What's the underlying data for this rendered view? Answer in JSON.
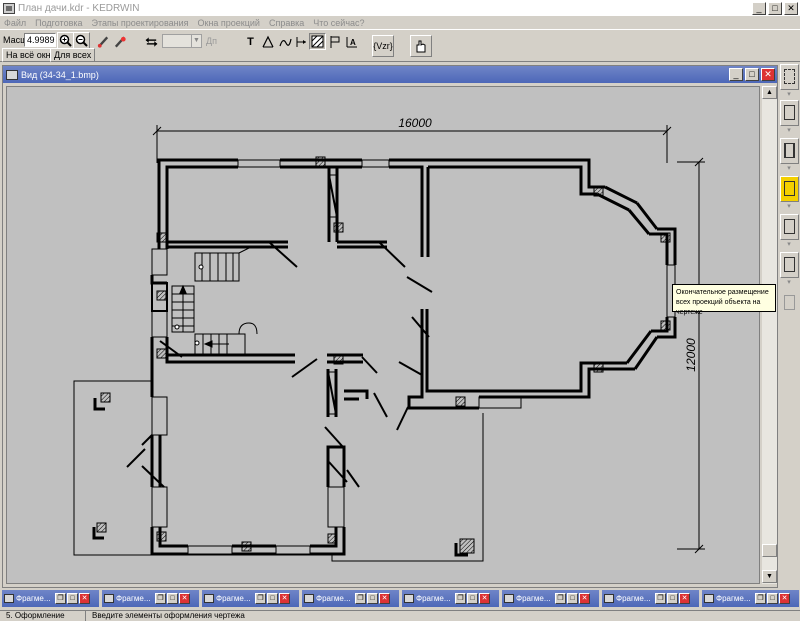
{
  "window": {
    "title": "План дачи.kdr - KEDRWIN",
    "minimize": "_",
    "maximize": "□",
    "close": "✕"
  },
  "menu": [
    "Файл",
    "Подготовка",
    "Этапы проектирования",
    "Окна проекций",
    "Справка",
    "Что сейчас?"
  ],
  "toolbar": {
    "scale_label": "Масшт",
    "scale_value": "4.9989",
    "fit_window": "На всё окно",
    "for_all": "Для всех",
    "combo_hint": "Дп",
    "formula_btn": "{Vzr}",
    "icons": [
      "zoom-in-icon",
      "zoom-out-icon",
      "pencil-icon",
      "eraser-icon",
      "arrows-icon",
      "text-icon",
      "angle-icon",
      "dimension-icon",
      "hatch-icon",
      "flag-icon",
      "leader-icon",
      "hand-icon"
    ]
  },
  "view": {
    "title": "Вид (34-34_1.bmp)",
    "dim_horizontal": "16000",
    "dim_vertical": "12000"
  },
  "tooltip": "Окончательное размещение всех проекций объекта на чертеже",
  "right_panel": {
    "buttons": [
      "fragment-icon",
      "stairs-icon",
      "level-icon",
      "placement-icon",
      "text-edit-icon",
      "sheet-icon",
      "print-icon"
    ]
  },
  "taskbar": {
    "items": [
      "Фрагме...",
      "Фрагме...",
      "Фрагме...",
      "Фрагме...",
      "Фрагме...",
      "Фрагме...",
      "Фрагме...",
      "Фрагме..."
    ]
  },
  "status": {
    "step": "5. Оформление",
    "hint": "Введите элементы оформления чертежа"
  },
  "colors": {
    "active_title": "#4d67b8",
    "canvas": "#c0c0c0",
    "tooltip_bg": "#ffffe1",
    "active_tool": "#f4d000"
  }
}
